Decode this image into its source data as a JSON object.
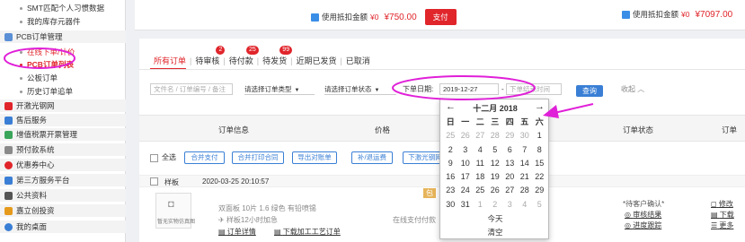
{
  "sidebar": {
    "items": [
      {
        "label": "SMT匹配个人习惯数据",
        "type": "sub"
      },
      {
        "label": "我的库存元器件",
        "type": "sub"
      },
      {
        "label": "PCB订单管理",
        "type": "section"
      },
      {
        "label": "在线下单/计价",
        "type": "sub"
      },
      {
        "label": "PCB订单列表",
        "type": "sub-active"
      },
      {
        "label": "公板订单",
        "type": "sub"
      },
      {
        "label": "历史订单追单",
        "type": "sub"
      },
      {
        "label": "开激光钢网",
        "type": "section"
      },
      {
        "label": "售后服务",
        "type": "section"
      },
      {
        "label": "增值税票开票管理",
        "type": "section"
      },
      {
        "label": "预付款系统",
        "type": "section"
      },
      {
        "label": "优惠券中心",
        "type": "section"
      },
      {
        "label": "第三方服务平台",
        "type": "section"
      },
      {
        "label": "公共资料",
        "type": "section"
      },
      {
        "label": "嘉立创投资",
        "type": "section"
      },
      {
        "label": "我的桌面",
        "type": "section"
      }
    ]
  },
  "payment": {
    "left": {
      "label": "使用抵扣金额",
      "amount": "¥0",
      "total": "¥750.00",
      "button": "支付"
    },
    "right": {
      "label": "使用抵扣金额",
      "amount": "¥0",
      "total": "¥7097.00"
    }
  },
  "tabs": [
    {
      "label": "所有订单",
      "badge": ""
    },
    {
      "label": "待审核",
      "badge": "2"
    },
    {
      "label": "待付款",
      "badge": "25"
    },
    {
      "label": "待发货",
      "badge": "99"
    },
    {
      "label": "近期已发货",
      "badge": ""
    },
    {
      "label": "已取消",
      "badge": ""
    }
  ],
  "filters": {
    "order_placeholder": "文件名 / 订单编号 / 备注",
    "order_type": "请选择订单类型",
    "order_status": "请选择订单状态",
    "date_label": "下单日期:",
    "date_value": "2019-12-27",
    "date_sep": "-",
    "date_end_placeholder": "下单结束时间",
    "search": "查询",
    "collapse": "收起"
  },
  "table_header": {
    "info": "订单信息",
    "price": "价格",
    "status": "订单状态",
    "ops": "订单"
  },
  "actions": {
    "select_all": "全选",
    "buttons": [
      "合并支付",
      "合并打印合同",
      "导出对账单",
      "补/退运费",
      "下激光钢网"
    ]
  },
  "order": {
    "type": "样板",
    "datetime": "2020-03-25 20:10:57",
    "thumb_caption": "暂无实物仿真图",
    "specs": "双面板 10片 1.6 绿色 有铅喷锡",
    "urgent": "样板12小时加急",
    "detail_link": "订单详情",
    "craft_link": "下载加工工艺订单",
    "pay_method": "在线支付付款",
    "pay_tag": "包",
    "status": "*待客户确认*",
    "status_link1": "审核结果",
    "status_link2": "进度跟踪",
    "op1": "修改",
    "op2": "下载",
    "op3": "更多"
  },
  "calendar": {
    "month": "十二月 2018",
    "prev": "←",
    "next": "→",
    "weekdays": [
      "日",
      "一",
      "二",
      "三",
      "四",
      "五",
      "六"
    ],
    "weeks": [
      [
        "25",
        "26",
        "27",
        "28",
        "29",
        "30",
        "1"
      ],
      [
        "2",
        "3",
        "4",
        "5",
        "6",
        "7",
        "8"
      ],
      [
        "9",
        "10",
        "11",
        "12",
        "13",
        "14",
        "15"
      ],
      [
        "16",
        "17",
        "18",
        "19",
        "20",
        "21",
        "22"
      ],
      [
        "23",
        "24",
        "25",
        "26",
        "27",
        "28",
        "29"
      ],
      [
        "30",
        "31",
        "1",
        "2",
        "3",
        "4",
        "5"
      ]
    ],
    "today": "今天",
    "clear": "清空"
  },
  "colors": {
    "accent": "#e0252b",
    "link": "#3a7fd5",
    "annotation": "#e020d8"
  }
}
